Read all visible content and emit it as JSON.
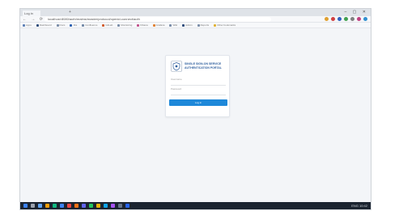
{
  "browser": {
    "tab_title": "Log in",
    "new_tab_glyph": "+",
    "window_controls": "– ▢ ✕",
    "nav_glyphs": "← → ⟳",
    "url": "localhost:8080/auth/realms/master/protocol/openid-connect/auth",
    "extensions": [
      "#e0a030",
      "#d04040",
      "#3060c0",
      "#40a050",
      "#808080",
      "#c04080",
      "#3090d0"
    ],
    "bookmarks": [
      {
        "label": "Apps",
        "color": "#5b7fb5"
      },
      {
        "label": "Dashboard",
        "color": "#2b4b7a"
      },
      {
        "label": "Docs",
        "color": "#7a8da8"
      },
      {
        "label": "Jira",
        "color": "#2a5fb0"
      },
      {
        "label": "Confluence",
        "color": "#7087a5"
      },
      {
        "label": "GitLab",
        "color": "#d05a2a"
      },
      {
        "label": "Monitoring",
        "color": "#7a8da8"
      },
      {
        "label": "Kibana",
        "color": "#c0508a"
      },
      {
        "label": "Grafana",
        "color": "#e08030"
      },
      {
        "label": "Wiki",
        "color": "#7a8da8"
      },
      {
        "label": "Admin",
        "color": "#2b4b7a"
      },
      {
        "label": "Reports",
        "color": "#7a8da8"
      },
      {
        "label": "Other bookmarks",
        "color": "#e0b030"
      }
    ]
  },
  "login": {
    "title_line1": "SINGLE SIGN-ON SERVICE",
    "title_line2": "AUTHENTICATION PORTAL",
    "username_label": "Username",
    "password_label": "Password",
    "submit_label": "Log in",
    "accent": "#1e88d9"
  },
  "taskbar": {
    "items": [
      "#3b82f6",
      "#9ca3af",
      "#60a5fa",
      "#f59e0b",
      "#10b981",
      "#3b82f6",
      "#ef4444",
      "#f97316",
      "#6366f1",
      "#22c55e",
      "#eab308",
      "#0ea5e9",
      "#a855f7",
      "#64748b",
      "#2563eb"
    ],
    "tray_text": "ENG 10:42"
  }
}
